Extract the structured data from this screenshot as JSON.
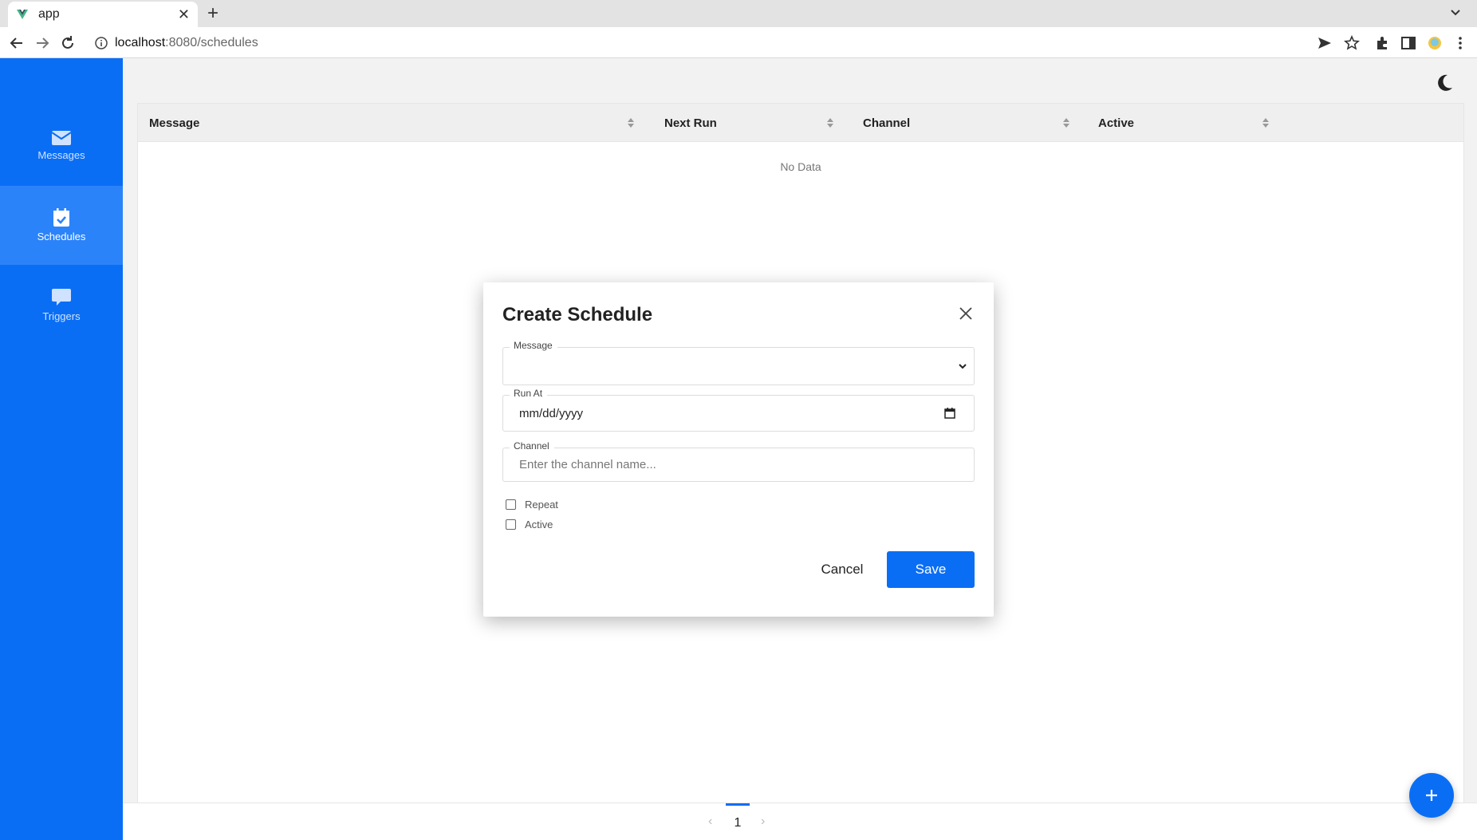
{
  "browser": {
    "tab_title": "app",
    "url_host": "localhost",
    "url_path": ":8080/schedules"
  },
  "sidebar": {
    "items": [
      {
        "label": "Messages",
        "icon": "envelope-icon"
      },
      {
        "label": "Schedules",
        "icon": "calendar-check-icon",
        "active": true
      },
      {
        "label": "Triggers",
        "icon": "chat-bubble-icon"
      }
    ]
  },
  "table": {
    "columns": [
      "Message",
      "Next Run",
      "Channel",
      "Active"
    ],
    "empty_text": "No Data"
  },
  "pagination": {
    "current_page": "1",
    "prev_icon": "chevron-left-icon",
    "next_icon": "chevron-right-icon"
  },
  "fab": {
    "icon": "plus-icon"
  },
  "modal": {
    "title": "Create Schedule",
    "message_label": "Message",
    "message_value": "",
    "run_at_label": "Run At",
    "run_at_value": "mm/dd/yyyy",
    "channel_label": "Channel",
    "channel_placeholder": "Enter the channel name...",
    "repeat_label": "Repeat",
    "repeat_checked": false,
    "active_label": "Active",
    "active_checked": false,
    "cancel_label": "Cancel",
    "save_label": "Save"
  },
  "colors": {
    "accent": "#0a6ef5",
    "sidebar_active": "#2b83fa"
  }
}
